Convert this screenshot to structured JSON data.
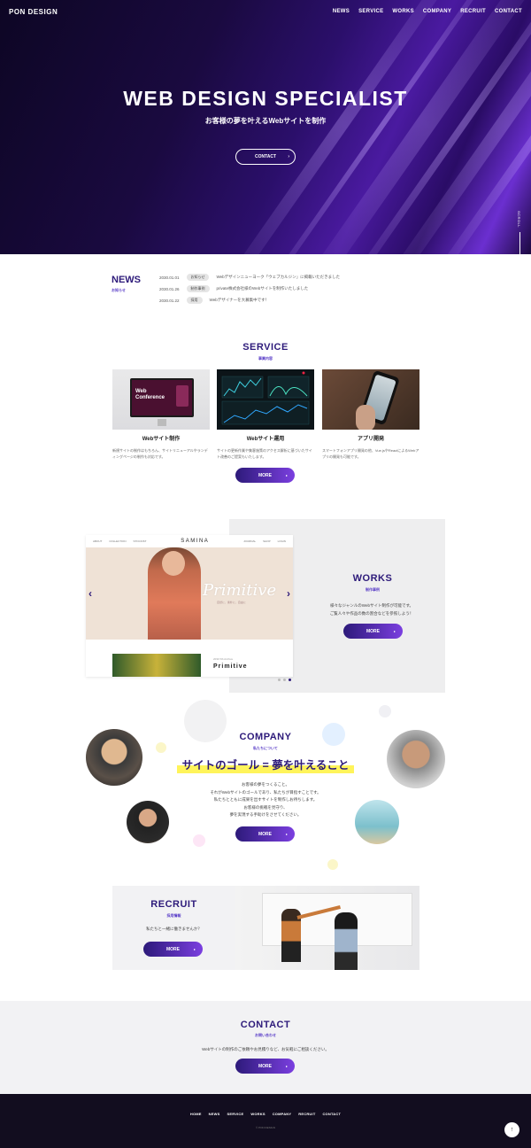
{
  "header": {
    "logo": "PON DESIGN",
    "nav": [
      "NEWS",
      "SERVICE",
      "WORKS",
      "COMPANY",
      "RECRUIT",
      "CONTACT"
    ]
  },
  "hero": {
    "title": "WEB DESIGN SPECIALIST",
    "subtitle": "お客様の夢を叶えるWebサイトを制作",
    "cta": "CONTACT",
    "cta_arrow": "›",
    "scroll": "SCROLL"
  },
  "news": {
    "title": "NEWS",
    "subtitle": "お知らせ",
    "items": [
      {
        "date": "2030.01.01",
        "tag": "お知らせ",
        "text": "Webデザインニューヨーク「ウェブカルジン」に掲載いただきました"
      },
      {
        "date": "2030.01.26",
        "tag": "制作事例",
        "text": "private株式会社様のWebサイトを制作いたしました"
      },
      {
        "date": "2030.01.22",
        "tag": "採用",
        "text": "Webデザイナーを大募集中です！"
      }
    ]
  },
  "service": {
    "title": "SERVICE",
    "subtitle": "事業内容",
    "more": "MORE",
    "arrow": "▸",
    "items": [
      {
        "name": "Webサイト制作",
        "desc": "新規サイトの制作はもちろん、サイトリニューアルやランディングページの制作も対応です。",
        "img_text": "Web Conference"
      },
      {
        "name": "Webサイト運用",
        "desc": "サイトの更新作業や集客施策のアクセス解析に基づいたサイト改善のご提案もいたします。"
      },
      {
        "name": "アプリ開発",
        "desc": "スマートフォンアプリ開発の他、Vue.jsやReactによるWebアプリの開発も可能です。"
      }
    ]
  },
  "works": {
    "title": "WORKS",
    "subtitle": "制作事例",
    "desc_line1": "様々なジャンルのWebサイト制作が可能です。",
    "desc_line2": "ご覧人々や作品の数の割合などを参照しよう！",
    "more": "MORE",
    "arrow": "▸",
    "shot": {
      "brand": "SAMINA",
      "nav_left": [
        "ABOUT",
        "COLLECTION",
        "STOCKIST"
      ],
      "nav_right": [
        "JOURNAL",
        "SHOP",
        "LOGIN"
      ],
      "script": "Primitive",
      "script_sub": "自然に、素朴に、自由に",
      "footer_kicker": "2030 SS Archive",
      "footer_title": "Primitive",
      "prev": "‹",
      "next": "›"
    }
  },
  "company": {
    "title": "COMPANY",
    "subtitle": "私たちについて",
    "tagline": "サイトのゴール = 夢を叶えること",
    "body": [
      "お客様の夢をつくること。",
      "それがWebサイトのゴールであり、私たちが目指すことです。",
      "私たちとともに成果を出すサイトを制作しお待ちします。",
      "お客様の挑戦を見守り、",
      "夢を実現する手助けをさせてください。"
    ],
    "more": "MORE",
    "arrow": "▸"
  },
  "recruit": {
    "title": "RECRUIT",
    "subtitle": "採用情報",
    "text": "私たちと一緒に働きませんか？",
    "more": "MORE",
    "arrow": "▸"
  },
  "contact": {
    "title": "CONTACT",
    "subtitle": "お問い合わせ",
    "text": "Webサイトの制作のご依頼やお見積りなど、お気軽にご相談ください。",
    "more": "MORE",
    "arrow": "▸"
  },
  "footer": {
    "nav": [
      "HOME",
      "NEWS",
      "SERVICE",
      "WORKS",
      "COMPANY",
      "RECRUIT",
      "CONTACT"
    ],
    "copyright": "© PON DESIGN",
    "totop": "↑"
  }
}
